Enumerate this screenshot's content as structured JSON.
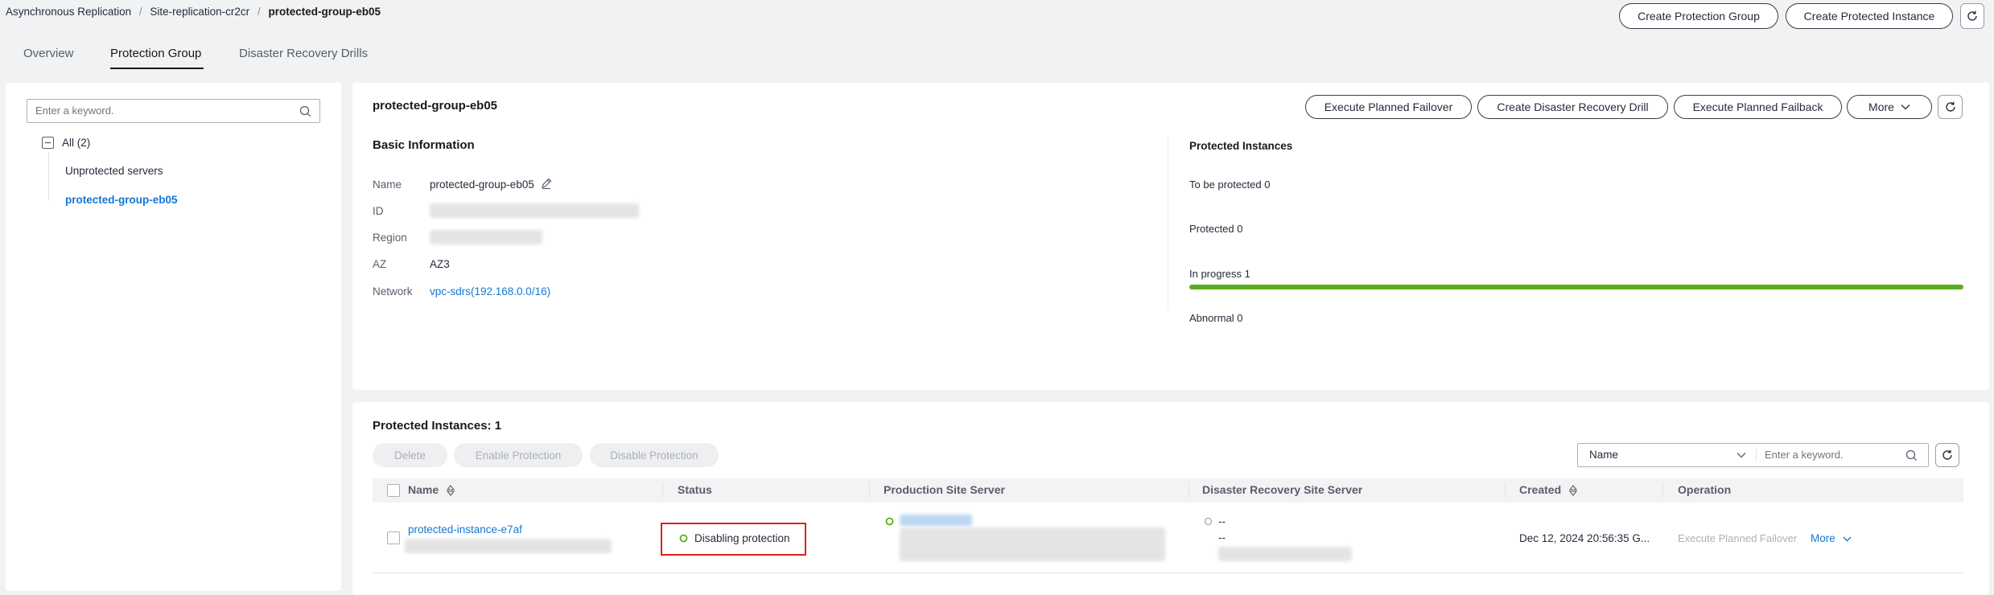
{
  "breadcrumb": {
    "items": [
      "Asynchronous Replication",
      "Site-replication-cr2cr",
      "protected-group-eb05"
    ],
    "separator": "/"
  },
  "header": {
    "create_group_label": "Create Protection Group",
    "create_instance_label": "Create Protected Instance"
  },
  "tabs": [
    {
      "label": "Overview"
    },
    {
      "label": "Protection Group",
      "active": true
    },
    {
      "label": "Disaster Recovery Drills"
    }
  ],
  "tree": {
    "search_placeholder": "Enter a keyword.",
    "root_label": "All (2)",
    "items": [
      {
        "label": "Unprotected servers"
      },
      {
        "label": "protected-group-eb05",
        "selected": true
      }
    ]
  },
  "group": {
    "title": "protected-group-eb05",
    "actions": {
      "failover": "Execute Planned Failover",
      "drill": "Create Disaster Recovery Drill",
      "failback": "Execute Planned Failback",
      "more": "More"
    },
    "basic": {
      "title": "Basic Information",
      "name_label": "Name",
      "name_value": "protected-group-eb05",
      "id_label": "ID",
      "region_label": "Region",
      "az_label": "AZ",
      "az_value": "AZ3",
      "network_label": "Network",
      "network_value": "vpc-sdrs(192.168.0.0/16)"
    },
    "instances": {
      "title": "Protected Instances",
      "to_be_protected": "To be protected 0",
      "protected": "Protected 0",
      "in_progress": "In progress 1",
      "in_progress_fraction": 1.0,
      "abnormal": "Abnormal 0"
    }
  },
  "table": {
    "title": "Protected Instances: 1",
    "batch": {
      "delete": "Delete",
      "enable": "Enable Protection",
      "disable": "Disable Protection"
    },
    "filter": {
      "field": "Name",
      "placeholder": "Enter a keyword."
    },
    "columns": {
      "name": "Name",
      "status": "Status",
      "production": "Production Site Server",
      "dr": "Disaster Recovery Site Server",
      "created": "Created",
      "operation": "Operation"
    },
    "rows": [
      {
        "name": "protected-instance-e7af",
        "status": "Disabling protection",
        "dr_line1": "--",
        "dr_line2": "--",
        "created": "Dec 12, 2024 20:56:35 G...",
        "op_failover": "Execute Planned Failover",
        "op_more": "More"
      }
    ]
  },
  "colors": {
    "accent": "#1476d6",
    "progress": "#5aae1e",
    "highlight": "#e0201b",
    "status_ok": "#5aae1e"
  }
}
